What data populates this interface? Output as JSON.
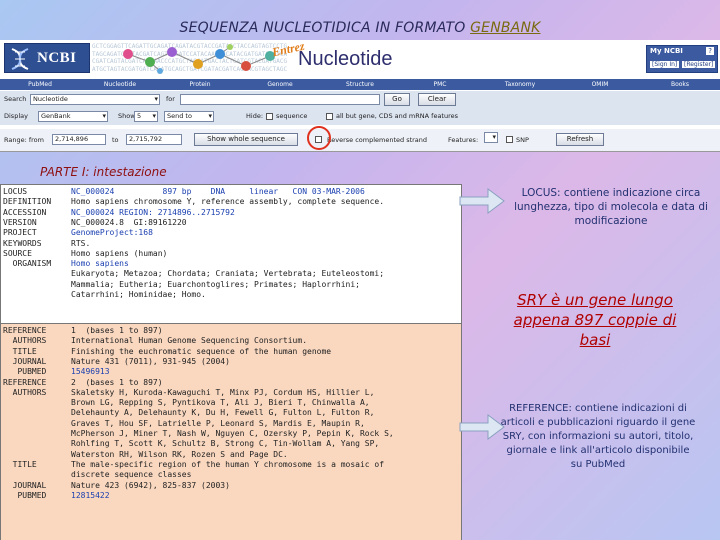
{
  "slide": {
    "title_prefix": "SEQUENZA NUCLEOTIDICA IN FORMATO ",
    "title_highlight": "GENBANK",
    "part_label": "PARTE I: intestazione"
  },
  "ncbi": {
    "logo_text": "NCBI",
    "entrez_word": "Entrez",
    "db_name": "Nucleotide",
    "my_ncbi": "My NCBI",
    "my_ncbi_help": "?",
    "sign_in": "[Sign In]",
    "register": "[Register]",
    "dna_text": [
      "GCTCGGAGTTCAGATTGCAGATCAGATACGTACCGATACCTACCAGTAGTCCTG",
      "TAGCAGATCAGTACGATCAGTACGATCCATACAATAGCATACGATGATCAGTCA",
      "CGATCAGTACGATCAGTAACCCATGCTAGCATGACTACTGATCGTACGATGACG",
      "ATGCTAGTACGATGATCAGATGCAGCTGATCGATACGATCAGTACGTAGCTAGC"
    ],
    "nav_tabs": [
      "PubMed",
      "Nucleotide",
      "Protein",
      "Genome",
      "Structure",
      "PMC",
      "Taxonomy",
      "OMIM",
      "Books"
    ],
    "search_label": "Search",
    "search_select": "Nucleotide",
    "for_label": "for",
    "go_button": "Go",
    "clear_button": "Clear",
    "display_label": "Display",
    "display_select": "GenBank",
    "show_label": "Show",
    "show_select": "5",
    "sendto_select": "Send to",
    "hide_label": "Hide:",
    "opt_sequence": "sequence",
    "opt_allbut": "all but gene, CDS and mRNA features",
    "range_label": "Range: from",
    "range_from": "2,714,896",
    "to_label": "to",
    "range_to": "2,715,792",
    "show_whole_button": "Show whole sequence",
    "reverse_label": "Reverse complemented strand",
    "features_label": "Features:",
    "snp_label": "SNP",
    "refresh_button": "Refresh"
  },
  "record": {
    "top_lines": [
      {
        "key": "LOCUS",
        "val": "NC_000024          897 bp    DNA     linear   CON 03-MAR-2006"
      },
      {
        "key": "DEFINITION",
        "val": "Homo sapiens chromosome Y, reference assembly, complete sequence."
      },
      {
        "key": "ACCESSION",
        "val": "NC_000024 REGION: 2714896..2715792"
      },
      {
        "key": "VERSION",
        "val": "NC_000024.8  GI:89161220"
      },
      {
        "key": "PROJECT",
        "val": "GenomeProject:168"
      },
      {
        "key": "KEYWORDS",
        "val": "RTS."
      },
      {
        "key": "SOURCE",
        "val": "Homo sapiens (human)"
      },
      {
        "key": "  ORGANISM",
        "val": "Homo sapiens"
      },
      {
        "key": "",
        "val": "Eukaryota; Metazoa; Chordata; Craniata; Vertebrata; Euteleostomi;"
      },
      {
        "key": "",
        "val": "Mammalia; Eutheria; Euarchontoglires; Primates; Haplorrhini;"
      },
      {
        "key": "",
        "val": "Catarrhini; Hominidae; Homo."
      }
    ],
    "bottom_lines": [
      {
        "key": "REFERENCE",
        "val": "1  (bases 1 to 897)"
      },
      {
        "key": "  AUTHORS",
        "val": "International Human Genome Sequencing Consortium."
      },
      {
        "key": "  TITLE",
        "val": "Finishing the euchromatic sequence of the human genome"
      },
      {
        "key": "  JOURNAL",
        "val": "Nature 431 (7011), 931-945 (2004)"
      },
      {
        "key": "   PUBMED",
        "val": "15496913"
      },
      {
        "key": "REFERENCE",
        "val": "2  (bases 1 to 897)"
      },
      {
        "key": "  AUTHORS",
        "val": "Skaletsky H, Kuroda-Kawaguchi T, Minx PJ, Cordum HS, Hillier L,"
      },
      {
        "key": "",
        "val": "Brown LG, Repping S, Pyntikova T, Ali J, Bieri T, Chinwalla A,"
      },
      {
        "key": "",
        "val": "Delehaunty A, Delehaunty K, Du H, Fewell G, Fulton L, Fulton R,"
      },
      {
        "key": "",
        "val": "Graves T, Hou SF, Latrielle P, Leonard S, Mardis E, Maupin R,"
      },
      {
        "key": "",
        "val": "McPherson J, Miner T, Nash W, Nguyen C, Ozersky P, Pepin K, Rock S,"
      },
      {
        "key": "",
        "val": "Rohlfing T, Scott K, Schultz B, Strong C, Tin-Wollam A, Yang SP,"
      },
      {
        "key": "",
        "val": "Waterston RH, Wilson RK, Rozen S and Page DC."
      },
      {
        "key": "  TITLE",
        "val": "The male-specific region of the human Y chromosome is a mosaic of"
      },
      {
        "key": "",
        "val": "discrete sequence classes"
      },
      {
        "key": "  JOURNAL",
        "val": "Nature 423 (6942), 825-837 (2003)"
      },
      {
        "key": "   PUBMED",
        "val": "12815422"
      }
    ]
  },
  "callouts": {
    "locus": "LOCUS: contiene indicazione circa lunghezza, tipo di molecola e data di modificazione",
    "sry": "SRY è un gene lungo appena 897 coppie di basi",
    "reference": "REFERENCE: contiene indicazioni di articoli e pubblicazioni riguardo il gene SRY, con informazioni su autori, titolo, giornale e link all'articolo disponibile su PubMed"
  },
  "colors": {
    "ncbi_blue": "#3b5aa0",
    "link_blue": "#1a3fb0",
    "reference_bg": "#fad8c0",
    "callout_text": "#223070",
    "sry_text": "#b00000",
    "circle_red": "#e0301e"
  }
}
